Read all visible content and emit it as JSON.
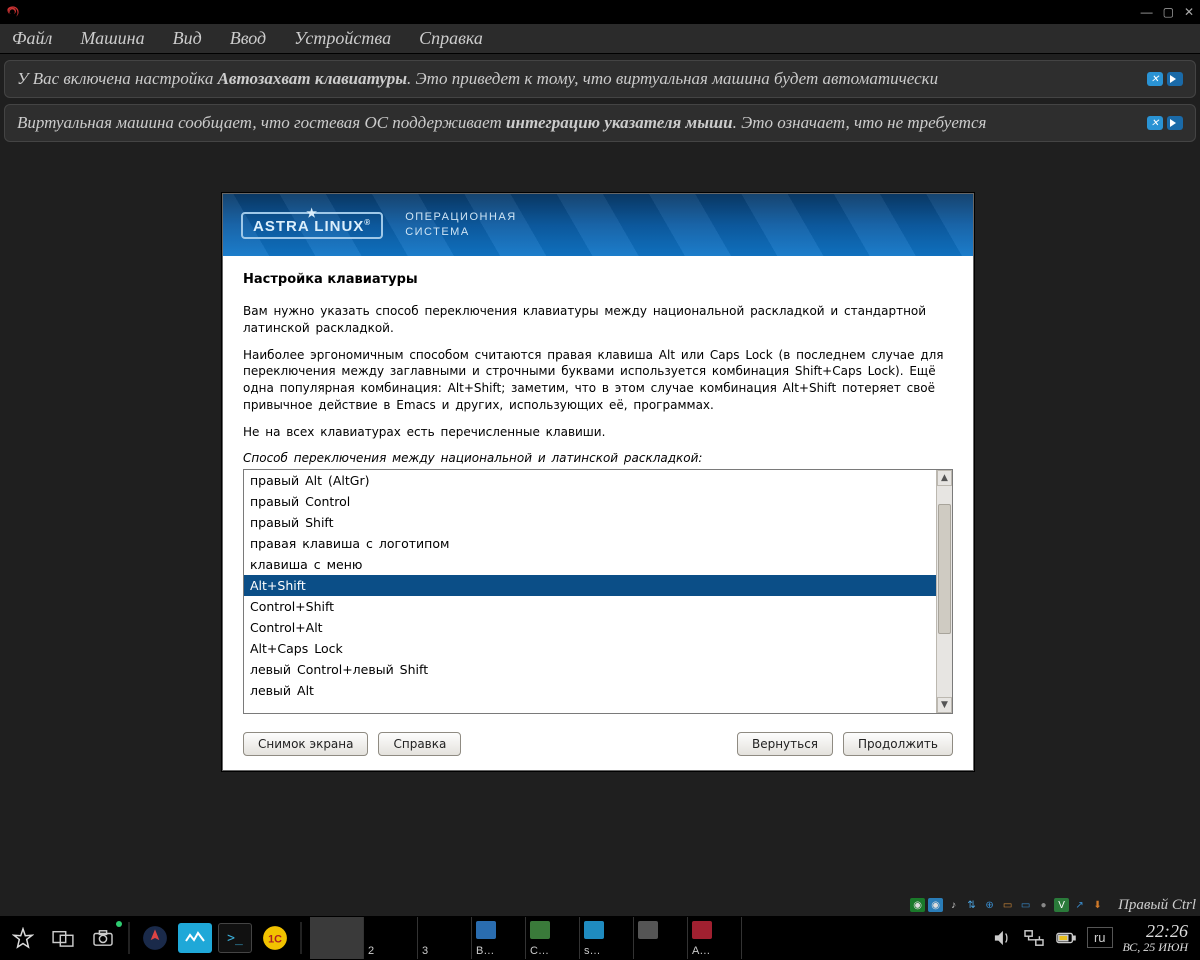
{
  "host": {
    "menus": [
      "Файл",
      "Машина",
      "Вид",
      "Ввод",
      "Устройства",
      "Справка"
    ],
    "window_controls": {
      "min": "—",
      "max": "▢",
      "close": "✕"
    }
  },
  "banners": [
    {
      "pre": "У Вас включена настройка ",
      "bold": "Автозахват клавиатуры",
      "post": ". Это приведет к тому, что виртуальная машина будет автоматически"
    },
    {
      "pre": "Виртуальная машина сообщает, что гостевая ОС поддерживает ",
      "bold": "интеграцию указателя мыши",
      "post": ". Это означает, что не требуется"
    }
  ],
  "installer": {
    "brand": "ASTRA LINUX",
    "brand_sub1": "ОПЕРАЦИОННАЯ",
    "brand_sub2": "СИСТЕМА",
    "title": "Настройка клавиатуры",
    "p1": "Вам нужно указать способ переключения клавиатуры между национальной раскладкой и стандартной латинской раскладкой.",
    "p2": "Наиболее эргономичным способом считаются правая клавиша Alt или Caps Lock (в последнем случае для переключения между заглавными и строчными буквами используется комбинация Shift+Caps Lock). Ещё одна популярная комбинация: Alt+Shift; заметим, что в этом случае комбинация Alt+Shift потеряет своё привычное действие в Emacs и других, использующих её, программах.",
    "p3": "Не на всех клавиатурах есть перечисленные клавиши.",
    "prompt": "Способ переключения между национальной и латинской раскладкой:",
    "options": [
      "правый Alt (AltGr)",
      "правый Control",
      "правый Shift",
      "правая клавиша с логотипом",
      "клавиша с меню",
      "Alt+Shift",
      "Control+Shift",
      "Control+Alt",
      "Alt+Caps Lock",
      "левый Control+левый Shift",
      "левый Alt"
    ],
    "selected_index": 5,
    "buttons": {
      "screenshot": "Снимок экрана",
      "help": "Справка",
      "back": "Вернуться",
      "continue": "Продолжить"
    }
  },
  "vb_status": {
    "host_key": "Правый Ctrl"
  },
  "taskbar": {
    "tasks": [
      {
        "label": "",
        "cls": "active"
      },
      {
        "label": "2"
      },
      {
        "label": "3"
      },
      {
        "label": "B…",
        "icon": "#2a6db0"
      },
      {
        "label": "C…",
        "icon": "#3a7a3a"
      },
      {
        "label": "s…",
        "icon": "#1f8bbf"
      },
      {
        "label": "",
        "icon": "#555"
      },
      {
        "label": "A…",
        "icon": "#a02030"
      }
    ],
    "lang": "ru",
    "time": "22:26",
    "date": "ВС, 25 ИЮН"
  }
}
